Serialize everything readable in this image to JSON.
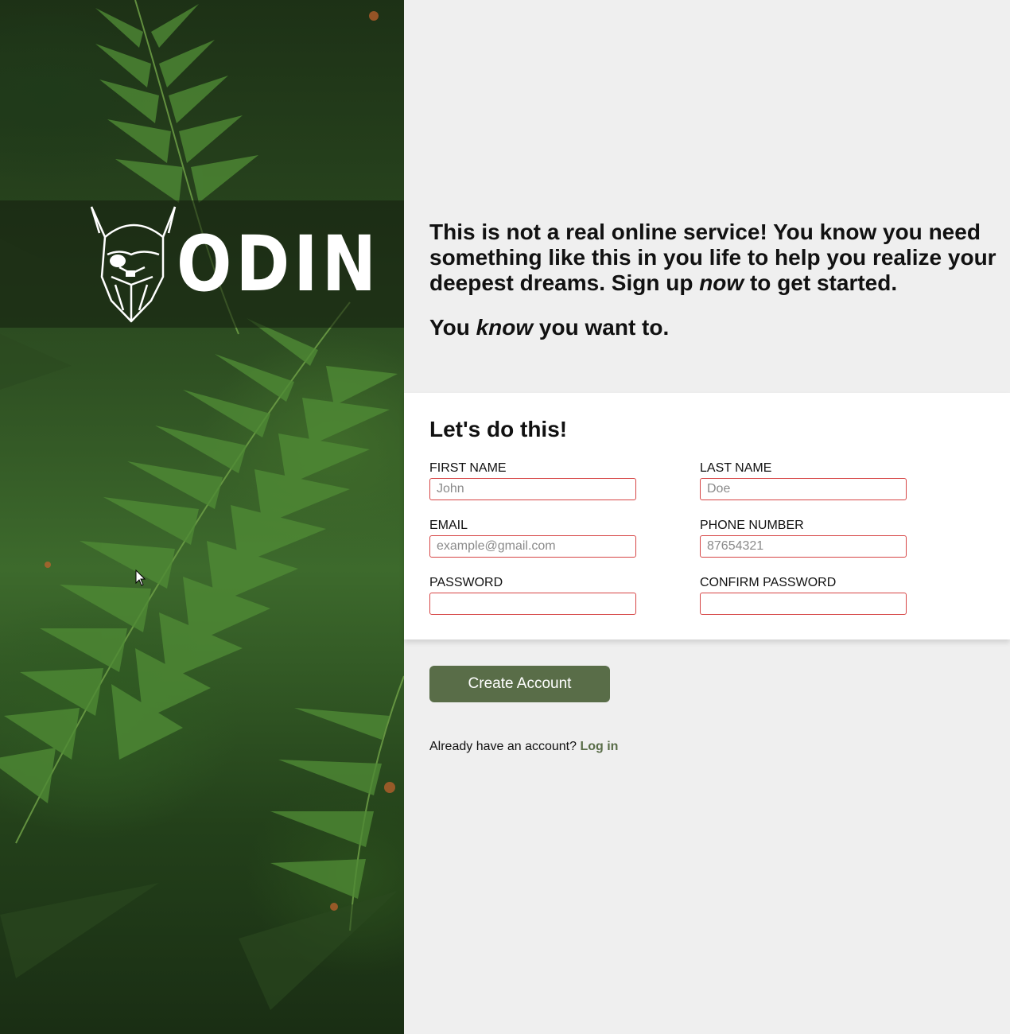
{
  "brand": {
    "logo_text": "ODIN",
    "logo_icon": "viking-head-icon"
  },
  "intro": {
    "paragraph1_a": "This is not a real online service! You know you need something like this in you life to help you realize your deepest dreams. Sign up ",
    "paragraph1_em": "now",
    "paragraph1_b": " to get started.",
    "paragraph2_a": "You ",
    "paragraph2_em": "know",
    "paragraph2_b": " you want to."
  },
  "form": {
    "title": "Let's do this!",
    "fields": {
      "first_name": {
        "label": "FIRST NAME",
        "placeholder": "John",
        "value": ""
      },
      "last_name": {
        "label": "LAST NAME",
        "placeholder": "Doe",
        "value": ""
      },
      "email": {
        "label": "EMAIL",
        "placeholder": "example@gmail.com",
        "value": ""
      },
      "phone": {
        "label": "PHONE NUMBER",
        "placeholder": "87654321",
        "value": ""
      },
      "password": {
        "label": "PASSWORD",
        "placeholder": "",
        "value": ""
      },
      "confirm_password": {
        "label": "CONFIRM PASSWORD",
        "placeholder": "",
        "value": ""
      }
    }
  },
  "actions": {
    "create_label": "Create Account",
    "login_prompt": "Already have an account? ",
    "login_link": "Log in"
  },
  "colors": {
    "accent": "#596d48",
    "input_border": "#d64545",
    "page_bg": "#efefef",
    "card_bg": "#ffffff"
  }
}
